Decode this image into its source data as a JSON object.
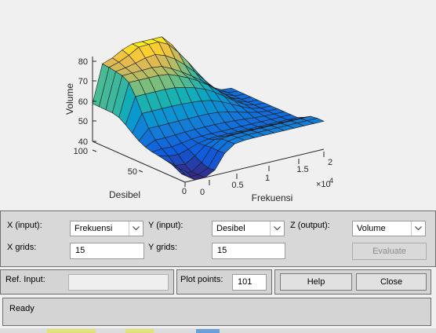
{
  "plot": {
    "z_axis_label": "Volume",
    "y_axis_label": "Desibel",
    "x_axis_label": "Frekuensi",
    "z_ticks": [
      "40",
      "50",
      "60",
      "70",
      "80"
    ],
    "y_ticks": [
      "0",
      "50",
      "100"
    ],
    "x_ticks": [
      "0",
      "0.5",
      "1",
      "1.5",
      "2"
    ],
    "x_exponent_base": "×10",
    "x_exponent_power": "4",
    "chart_data": {
      "type": "surface",
      "x_label": "Frekuensi",
      "y_label": "Desibel",
      "z_label": "Volume",
      "xlim": [
        0,
        20000
      ],
      "ylim": [
        0,
        100
      ],
      "zlim": [
        40,
        85
      ],
      "grid_size": [
        15,
        15
      ],
      "grid": true,
      "colormap": "parula"
    }
  },
  "controls": {
    "x_input_label": "X (input):",
    "x_input_value": "Frekuensi",
    "y_input_label": "Y (input):",
    "y_input_value": "Desibel",
    "z_output_label": "Z (output):",
    "z_output_value": "Volume",
    "x_grids_label": "X grids:",
    "x_grids_value": "15",
    "y_grids_label": "Y grids:",
    "y_grids_value": "15",
    "evaluate_label": "Evaluate"
  },
  "bottom": {
    "ref_input_label": "Ref. Input:",
    "ref_input_value": "",
    "plot_points_label": "Plot points:",
    "plot_points_value": "101",
    "help_label": "Help",
    "close_label": "Close"
  },
  "status": {
    "text": "Ready"
  },
  "colors": {
    "panel_bg": "#d4d4d4",
    "plot_bg": "#f0f0f0",
    "colormap": "parula"
  }
}
